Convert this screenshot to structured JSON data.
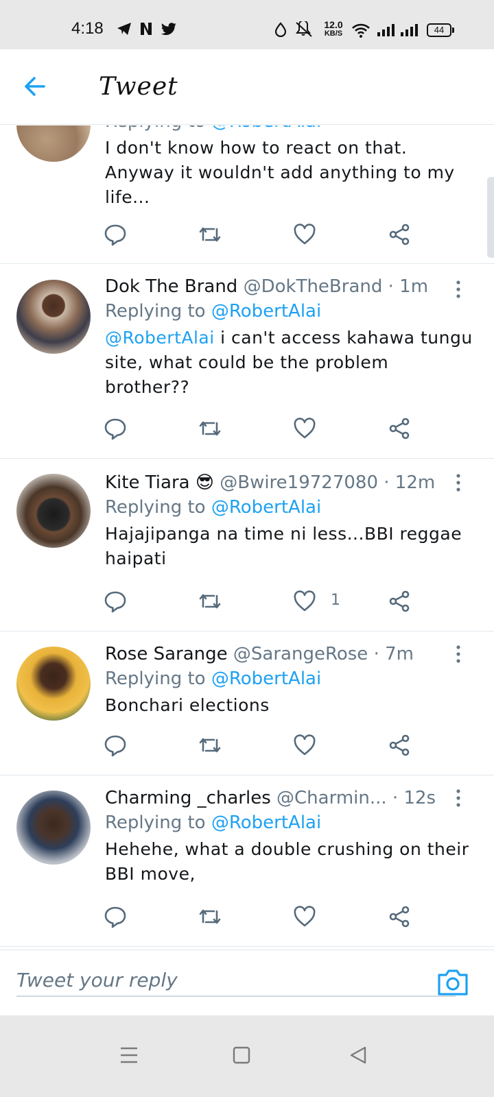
{
  "status_bar": {
    "time": "4:18",
    "net_speed_value": "12.0",
    "net_speed_unit": "KB/S",
    "battery": "44"
  },
  "header": {
    "title": "Tweet",
    "back_icon": "arrow-left-icon"
  },
  "tweets": [
    {
      "name": "",
      "handle": "",
      "time": "",
      "replying_prefix": "Replying to",
      "replying_to": "@RobertAlai",
      "body_mention": "",
      "body": "I don't know how to react on that. Anyway it wouldn't add anything to my life...",
      "likes": ""
    },
    {
      "name": "Dok The Brand",
      "handle": "@DokTheBrand",
      "time": "· 1m",
      "replying_prefix": "Replying to",
      "replying_to": "@RobertAlai",
      "body_mention": "@RobertAlai",
      "body": " i can't access kahawa tungu site, what could be the problem brother??",
      "likes": ""
    },
    {
      "name": "Kite Tiara 😎",
      "handle": "@Bwire19727080",
      "time": "· 12m",
      "replying_prefix": "Replying to",
      "replying_to": "@RobertAlai",
      "body_mention": "",
      "body": "Hajajipanga na time ni less...BBI reggae haipati",
      "likes": "1"
    },
    {
      "name": "Rose Sarange",
      "handle": "@SarangeRose",
      "time": "· 7m",
      "replying_prefix": "Replying to",
      "replying_to": "@RobertAlai",
      "body_mention": "",
      "body": "Bonchari elections",
      "likes": ""
    },
    {
      "name": "Charming _charles",
      "handle": "@Charmin...",
      "time": "· 12s",
      "replying_prefix": "Replying to",
      "replying_to": "@RobertAlai",
      "body_mention": "",
      "body": "Hehehe,  what a double crushing on their BBI move,",
      "likes": ""
    }
  ],
  "reply_bar": {
    "placeholder": "Tweet your reply",
    "camera_icon": "camera-icon"
  },
  "nav_bar": {
    "items": [
      "menu-icon",
      "home-square-icon",
      "back-triangle-icon"
    ]
  },
  "colors": {
    "accent": "#1da1f2",
    "secondary_text": "#657786",
    "divider": "#e1e8ed",
    "system_bar": "#e8e8e8"
  }
}
